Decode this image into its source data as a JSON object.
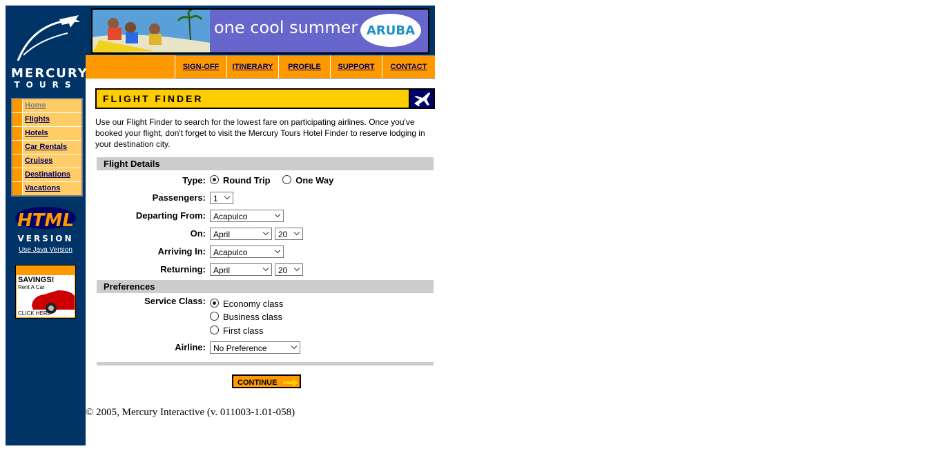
{
  "brand": {
    "logo_line1": "MERCURY",
    "logo_line2": "TOURS"
  },
  "banner": {
    "text": "one cool summer",
    "badge": "ARUBA"
  },
  "top_nav": [
    "SIGN-OFF",
    "ITINERARY",
    "PROFILE",
    "SUPPORT",
    "CONTACT"
  ],
  "left_nav": [
    "Home",
    "Flights",
    "Hotels",
    "Car Rentals",
    "Cruises",
    "Destinations",
    "Vacations"
  ],
  "html_version": {
    "line1": "HTML",
    "line2": "VERSION",
    "java_link": "Use Java Version"
  },
  "ad": {
    "title": "SAVINGS!",
    "subtitle": "Rent A Car",
    "cta": "CLICK HERE"
  },
  "finder": {
    "title": "FLIGHT FINDER",
    "intro": "Use our Flight Finder to search for the lowest fare on participating airlines. Once you've booked your flight, don't forget to visit the Mercury Tours Hotel Finder to reserve lodging in your destination city.",
    "section_details": "Flight Details",
    "section_prefs": "Preferences",
    "labels": {
      "type": "Type:",
      "passengers": "Passengers:",
      "departing_from": "Departing From:",
      "on": "On:",
      "arriving_in": "Arriving In:",
      "returning": "Returning:",
      "service_class": "Service Class:",
      "airline": "Airline:"
    },
    "type_options": [
      "Round Trip",
      "One Way"
    ],
    "type_selected": "Round Trip",
    "passengers": "1",
    "departing_from": "Acapulco",
    "on_month": "April",
    "on_day": "20",
    "arriving_in": "Acapulco",
    "return_month": "April",
    "return_day": "20",
    "service_classes": [
      "Economy class",
      "Business class",
      "First class"
    ],
    "service_selected": "Economy class",
    "airline": "No Preference",
    "continue_label": "CONTINUE"
  },
  "footer": {
    "copyright": "© 2005, Mercury Interactive (v. 011003-1.01-058)"
  },
  "colors": {
    "sidebar": "#003366",
    "nav_orange": "#ff9900",
    "header_yellow": "#ffcc00",
    "banner_purple": "#6666cc"
  }
}
